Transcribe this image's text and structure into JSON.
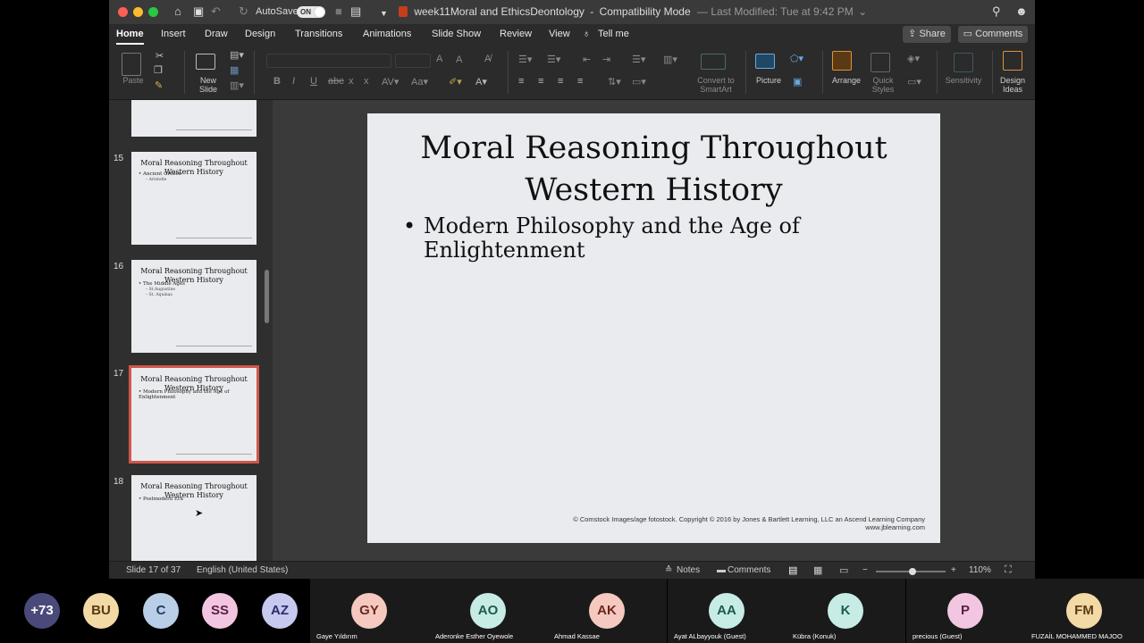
{
  "titlebar": {
    "autosave_label": "AutoSave",
    "autosave_state": "ON",
    "document_title": "week11Moral and EthicsDeontology",
    "separator": "-",
    "mode": "Compatibility Mode",
    "last_modified": "— Last Modified: Tue at 9:42 PM",
    "chevron": "⌄"
  },
  "tabs": [
    "Home",
    "Insert",
    "Draw",
    "Design",
    "Transitions",
    "Animations",
    "Slide Show",
    "Review",
    "View"
  ],
  "tell_me": "Tell me",
  "share_label": "Share",
  "comments_label": "Comments",
  "ribbon": {
    "paste": "Paste",
    "new_slide_line1": "New",
    "new_slide_line2": "Slide",
    "convert_line1": "Convert to",
    "convert_line2": "SmartArt",
    "picture": "Picture",
    "arrange": "Arrange",
    "quick_styles_line1": "Quick",
    "quick_styles_line2": "Styles",
    "sensitivity": "Sensitivity",
    "design_ideas_line1": "Design",
    "design_ideas_line2": "Ideas"
  },
  "thumbnails": [
    {
      "number": "15",
      "title": "Moral Reasoning Throughout Western History",
      "bullet": "• Ancient Greece",
      "subs": [
        "– Aristotle"
      ],
      "selected": false
    },
    {
      "number": "16",
      "title": "Moral Reasoning Throughout Western History",
      "bullet": "• The Middle Ages",
      "subs": [
        "– St.Augustine",
        "– St. Aquinas"
      ],
      "selected": false
    },
    {
      "number": "17",
      "title": "Moral Reasoning Throughout Western History",
      "bullet": "• Modern Philosophy and the Age of Enlightenment",
      "subs": [],
      "selected": true
    },
    {
      "number": "18",
      "title": "Moral Reasoning Throughout Western History",
      "bullet": "• Postmodern Era",
      "subs": [],
      "selected": false
    }
  ],
  "slide": {
    "title_line1": "Moral Reasoning Throughout",
    "title_line2": "Western History",
    "bullet_line1": "Modern Philosophy and the Age of",
    "bullet_line2": "Enlightenment",
    "credit_line1": "© Comstock Images/age fotostock. Copyright © 2016 by Jones & Bartlett Learning, LLC an Ascend Learning Company",
    "credit_line2": "www.jblearning.com"
  },
  "status": {
    "slide_counter": "Slide 17 of 37",
    "language": "English (United States)",
    "notes": "Notes",
    "comments": "Comments",
    "zoom_minus": "−",
    "zoom_plus": "+",
    "zoom_level": "110%",
    "zoom_fraction": 0.53
  },
  "participants": [
    {
      "initials": "+73",
      "name": "",
      "bg": "#4a4a7a",
      "fg": "#ffffff"
    },
    {
      "initials": "BU",
      "name": "",
      "bg": "#f3d9a6",
      "fg": "#5a3a10"
    },
    {
      "initials": "C",
      "name": "",
      "bg": "#b9cfe8",
      "fg": "#1f3b5a"
    },
    {
      "initials": "SS",
      "name": "",
      "bg": "#f2c6e0",
      "fg": "#5a1f45"
    },
    {
      "initials": "AZ",
      "name": "",
      "bg": "#c7c9ee",
      "fg": "#2a2d6b"
    },
    {
      "initials": "GY",
      "name": "Gaye Yıldırım",
      "bg": "#f5c9c0",
      "fg": "#6a2a1f"
    },
    {
      "initials": "AO",
      "name": "Aderonke Esther Oyewole",
      "bg": "#c7ece5",
      "fg": "#1f5a4e"
    },
    {
      "initials": "AK",
      "name": "Ahmad Kassae",
      "bg": "#f5c9c0",
      "fg": "#6a2a1f"
    },
    {
      "initials": "AA",
      "name": "Ayat ALbayyouk (Guest)",
      "bg": "#c7ece5",
      "fg": "#1f5a4e"
    },
    {
      "initials": "K",
      "name": "Kübra  (Konuk)",
      "bg": "#c7ece5",
      "fg": "#1f5a4e"
    },
    {
      "initials": "P",
      "name": "precious (Guest)",
      "bg": "#f2c6e0",
      "fg": "#5a1f45"
    },
    {
      "initials": "FM",
      "name": "FUZAİL MOHAMMED MAJOO",
      "bg": "#f3d9a6",
      "fg": "#5a3a10"
    }
  ]
}
